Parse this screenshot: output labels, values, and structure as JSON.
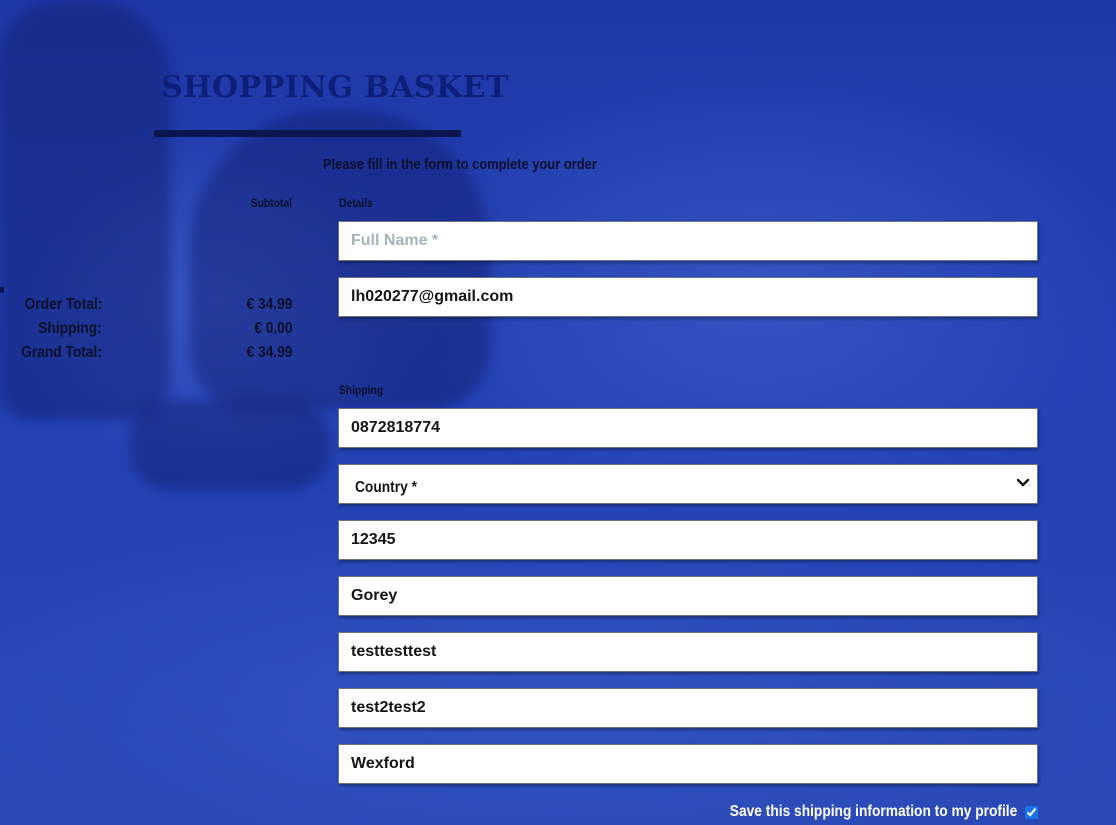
{
  "page": {
    "title": "SHOPPING BASKET",
    "intro": "Please fill in the form to complete your order"
  },
  "summary": {
    "subtotal_label": "Subtotal",
    "order_total_label": "Order Total:",
    "order_total_value": "€ 34.99",
    "shipping_label": "Shipping:",
    "shipping_value": "€ 0.00",
    "grand_total_label": "Grand Total:",
    "grand_total_value": "€ 34.99"
  },
  "details": {
    "label": "Details",
    "full_name": {
      "value": "",
      "placeholder": "Full Name *"
    },
    "email": {
      "value": "lh020277@gmail.com",
      "placeholder": ""
    }
  },
  "shipping": {
    "label": "Shipping",
    "phone": {
      "value": "0872818774"
    },
    "country": {
      "selected": "Country *"
    },
    "postcode": {
      "value": "12345"
    },
    "town": {
      "value": "Gorey"
    },
    "street1": {
      "value": "testtesttest"
    },
    "street2": {
      "value": "test2test2"
    },
    "county": {
      "value": "Wexford"
    },
    "save_label": "Save this shipping information to my profile",
    "save_checked": true
  },
  "icons": {
    "select_chevron": "chevron-down-icon",
    "save_checkbox": "checkbox-checked-icon"
  },
  "colors": {
    "background": "#1e3ab0",
    "title": "#0e1f7a",
    "title_rule": "#0b1550",
    "text_dark": "#0b0f2a",
    "save_text": "#ffffff",
    "placeholder": "#a9b1bd"
  }
}
